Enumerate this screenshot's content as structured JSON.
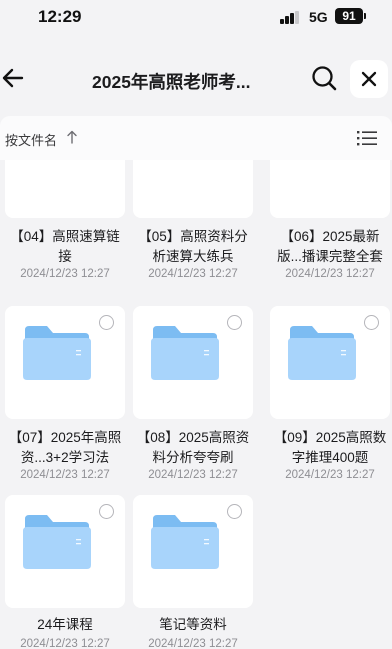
{
  "status_bar": {
    "time": "12:29",
    "network": "5G",
    "battery": "91"
  },
  "nav": {
    "title": "2025年高照老师考..."
  },
  "sort": {
    "label": "按文件名"
  },
  "files": [
    {
      "name": "【04】高照速算链接",
      "date": "2024/12/23 12:27"
    },
    {
      "name": "【05】高照资料分析速算大练兵",
      "date": "2024/12/23 12:27"
    },
    {
      "name": "【06】2025最新版...播课完整全套",
      "date": "2024/12/23 12:27"
    },
    {
      "name": "【07】2025年高照资...3+2学习法",
      "date": "2024/12/23 12:27"
    },
    {
      "name": "【08】2025高照资料分析夸夸刷",
      "date": "2024/12/23 12:27"
    },
    {
      "name": "【09】2025高照数字推理400题",
      "date": "2024/12/23 12:27"
    },
    {
      "name": "24年课程",
      "date": "2024/12/23 12:27"
    },
    {
      "name": "笔记等资料",
      "date": "2024/12/23 12:27"
    }
  ],
  "colors": {
    "folder_back": "#7cbcf2",
    "folder_front": "#a8d4fb",
    "accent": "#1677ff"
  }
}
